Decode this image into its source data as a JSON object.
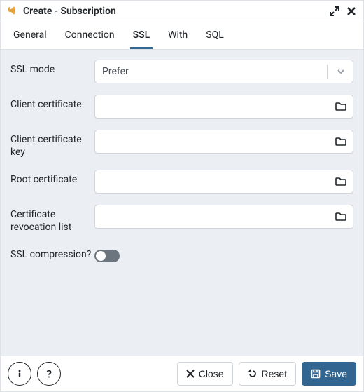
{
  "titlebar": {
    "title": "Create - Subscription"
  },
  "tabs": [
    {
      "id": "general",
      "label": "General",
      "active": false
    },
    {
      "id": "connection",
      "label": "Connection",
      "active": false
    },
    {
      "id": "ssl",
      "label": "SSL",
      "active": true
    },
    {
      "id": "with",
      "label": "With",
      "active": false
    },
    {
      "id": "sql",
      "label": "SQL",
      "active": false
    }
  ],
  "ssl": {
    "mode_label": "SSL mode",
    "mode_value": "Prefer",
    "client_cert_label": "Client certificate",
    "client_cert_value": "",
    "client_key_label": "Client certificate key",
    "client_key_value": "",
    "root_cert_label": "Root certificate",
    "root_cert_value": "",
    "crl_label": "Certificate revocation list",
    "crl_value": "",
    "compression_label": "SSL compression?",
    "compression_on": false
  },
  "footer": {
    "close_label": "Close",
    "reset_label": "Reset",
    "save_label": "Save"
  }
}
